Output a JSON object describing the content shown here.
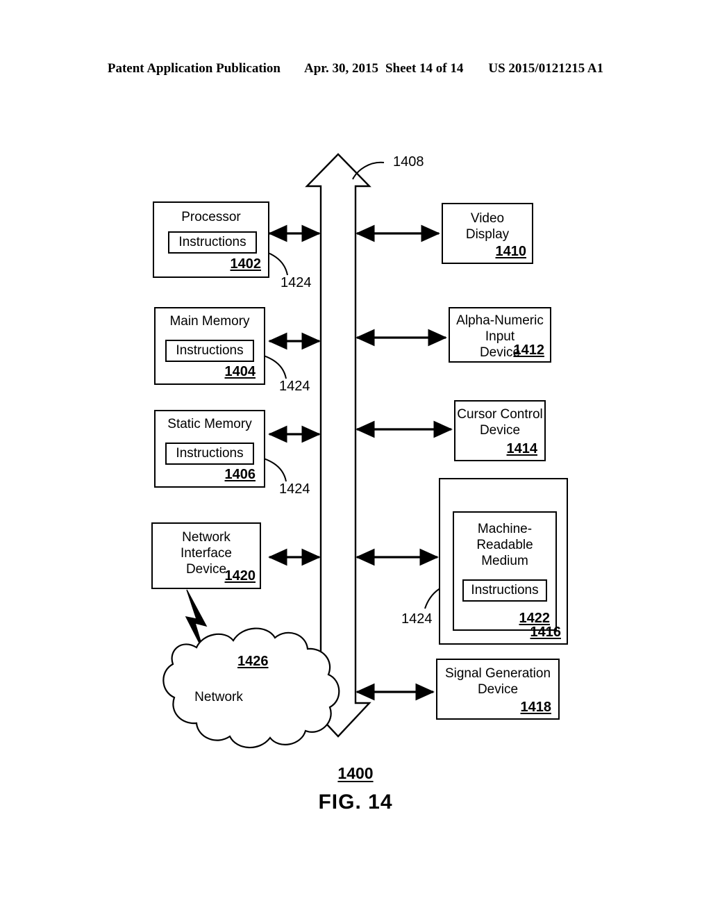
{
  "header": {
    "publication": "Patent Application Publication",
    "date": "Apr. 30, 2015",
    "sheet": "Sheet 14 of 14",
    "patent_number": "US 2015/0121215 A1"
  },
  "figure": {
    "caption": "FIG. 14",
    "system_ref": "1400",
    "bus_ref": "1408"
  },
  "left_column": [
    {
      "title": "Processor",
      "ref": "1402",
      "inner_label": "Instructions",
      "leader_ref": "1424"
    },
    {
      "title": "Main Memory",
      "ref": "1404",
      "inner_label": "Instructions",
      "leader_ref": "1424"
    },
    {
      "title": "Static Memory",
      "ref": "1406",
      "inner_label": "Instructions",
      "leader_ref": "1424"
    },
    {
      "title": "Network\nInterface\nDevice",
      "ref": "1420"
    }
  ],
  "right_column": [
    {
      "title": "Video\nDisplay",
      "ref": "1410"
    },
    {
      "title": "Alpha-Numeric\nInput\nDevice",
      "ref": "1412"
    },
    {
      "title": "Cursor Control\nDevice",
      "ref": "1414"
    },
    {
      "title": "Machine-\nReadable\nMedium",
      "ref": "1416",
      "medium_ref": "1422",
      "inner_label": "Instructions",
      "leader_ref": "1424"
    },
    {
      "title": "Signal Generation\nDevice",
      "ref": "1418"
    }
  ],
  "network": {
    "label": "Network",
    "ref": "1426"
  },
  "colors": {
    "ink": "#000000",
    "paper": "#ffffff"
  }
}
